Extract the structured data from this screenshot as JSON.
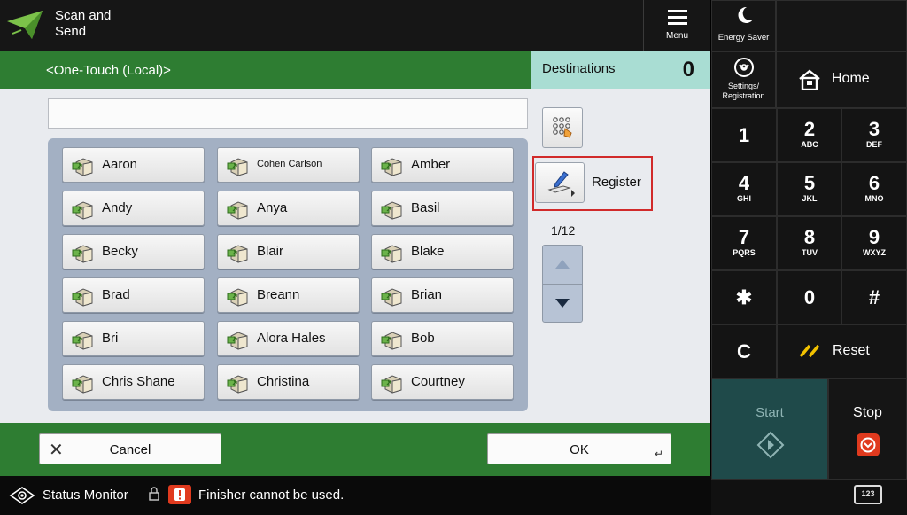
{
  "app": {
    "title": "Scan and\nSend",
    "icon": "scan-and-send-icon"
  },
  "menu": {
    "label": "Menu",
    "icon": "hamburger-icon"
  },
  "right_panel": {
    "energy_saver": "Energy Saver",
    "settings": "Settings/\nRegistration",
    "home": "Home",
    "keys": [
      {
        "digit": "1",
        "letters": ""
      },
      {
        "digit": "2",
        "letters": "ABC"
      },
      {
        "digit": "3",
        "letters": "DEF"
      },
      {
        "digit": "4",
        "letters": "GHI"
      },
      {
        "digit": "5",
        "letters": "JKL"
      },
      {
        "digit": "6",
        "letters": "MNO"
      },
      {
        "digit": "7",
        "letters": "PQRS"
      },
      {
        "digit": "8",
        "letters": "TUV"
      },
      {
        "digit": "9",
        "letters": "WXYZ"
      },
      {
        "digit": "✱",
        "letters": ""
      },
      {
        "digit": "0",
        "letters": ""
      },
      {
        "digit": "#",
        "letters": ""
      }
    ],
    "clear": "C",
    "reset": "Reset",
    "start": "Start",
    "stop": "Stop",
    "keyboard_icon_text": "123"
  },
  "list": {
    "title": "<One-Touch (Local)>",
    "search_value": "",
    "destinations_label": "Destinations",
    "destinations_count": "0",
    "entries": [
      "Aaron",
      "Cohen Carlson",
      "Amber",
      "Andy",
      "Anya",
      "Basil",
      "Becky",
      "Blair",
      "Blake",
      "Brad",
      "Breann",
      "Brian",
      "Bri",
      "Alora Hales",
      "Bob",
      "Chris Shane",
      "Christina",
      "Courtney"
    ],
    "small_entries": [
      "Cohen Carlson"
    ],
    "register": "Register",
    "page_indicator": "1/12"
  },
  "footer": {
    "cancel": "Cancel",
    "ok": "OK"
  },
  "status": {
    "monitor": "Status Monitor",
    "message": "Finisher cannot be used."
  },
  "colors": {
    "green": "#2e7d32",
    "teal": "#a9ddd3",
    "highlight": "#d12a2a"
  }
}
